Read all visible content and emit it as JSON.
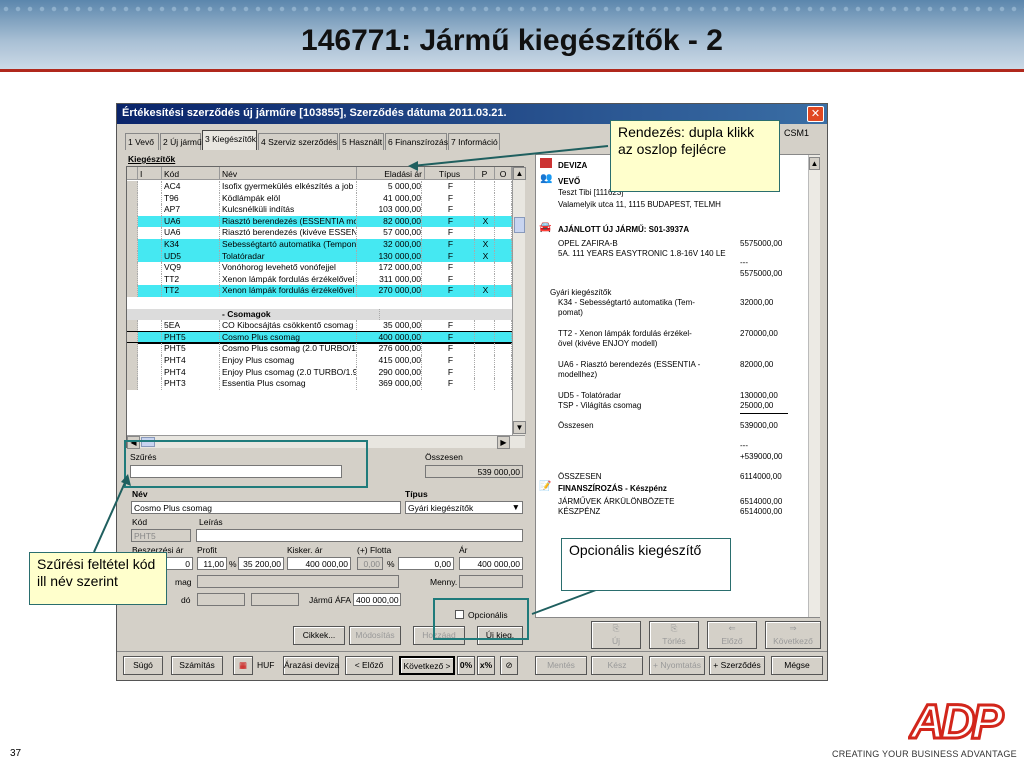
{
  "slide": {
    "title": "146771: Jármű kiegészítők - 2",
    "page": "37",
    "tagline": "CREATING YOUR BUSINESS ADVANTAGE",
    "logo": "ADP"
  },
  "window": {
    "title": "Értékesítési szerződés új járműre [103855], Szerződés dátuma 2011.03.21.",
    "csm": "CSM1"
  },
  "tabs": [
    "1 Vevő",
    "2 Új jármű",
    "3 Kiegészítők",
    "4 Szerviz szerződés",
    "5 Használt",
    "6 Finanszírozás",
    "7 Információ"
  ],
  "grid": {
    "section_label": "Kiegészítők",
    "headers": [
      "I",
      "Kód",
      "Név",
      "Eladási ár",
      "Típus",
      "P",
      "O"
    ],
    "group_label": "- Csomagok",
    "rows": [
      {
        "kod": "AC4",
        "nev": "Isofix gyermekülés elkészítés a job",
        "ar": "5 000,00",
        "tipus": "F",
        "p": ""
      },
      {
        "kod": "T96",
        "nev": "Ködlámpák elöl",
        "ar": "41 000,00",
        "tipus": "F",
        "p": ""
      },
      {
        "kod": "AP7",
        "nev": "Kulcsnélküli indítás",
        "ar": "103 000,00",
        "tipus": "F",
        "p": ""
      },
      {
        "kod": "UA6",
        "nev": "Riasztó berendezés (ESSENTIA mc",
        "ar": "82 000,00",
        "tipus": "F",
        "p": "X",
        "hl": true
      },
      {
        "kod": "UA6",
        "nev": "Riasztó berendezés (kivéve ESSEN",
        "ar": "57 000,00",
        "tipus": "F",
        "p": ""
      },
      {
        "kod": "K34",
        "nev": "Sebességtartó automatika (Tempon",
        "ar": "32 000,00",
        "tipus": "F",
        "p": "X",
        "hl": true
      },
      {
        "kod": "UD5",
        "nev": "Tolatóradar",
        "ar": "130 000,00",
        "tipus": "F",
        "p": "X",
        "hl": true
      },
      {
        "kod": "VQ9",
        "nev": "Vonóhorog levehető vonófejjel",
        "ar": "172 000,00",
        "tipus": "F",
        "p": ""
      },
      {
        "kod": "TT2",
        "nev": "Xenon lámpák fordulás érzékelővel",
        "ar": "311 000,00",
        "tipus": "F",
        "p": ""
      },
      {
        "kod": "TT2",
        "nev": "Xenon lámpák fordulás érzékelővel",
        "ar": "270 000,00",
        "tipus": "F",
        "p": "X",
        "hl": true
      },
      {
        "kod": "5EA",
        "nev": "CO Kibocsájtás csökkentő csomag",
        "ar": "35 000,00",
        "tipus": "F",
        "p": ""
      },
      {
        "kod": "PHT5",
        "nev": "Cosmo Plus csomag",
        "ar": "400 000,00",
        "tipus": "F",
        "p": "",
        "hl": true
      },
      {
        "kod": "PHT5",
        "nev": "Cosmo Plus csomag (2.0 TURBO/1",
        "ar": "276 000,00",
        "tipus": "F",
        "p": ""
      },
      {
        "kod": "PHT4",
        "nev": "Enjoy Plus csomag",
        "ar": "415 000,00",
        "tipus": "F",
        "p": ""
      },
      {
        "kod": "PHT4",
        "nev": "Enjoy Plus csomag (2.0 TURBO/1.9",
        "ar": "290 000,00",
        "tipus": "F",
        "p": ""
      },
      {
        "kod": "PHT3",
        "nev": "Essentia Plus csomag",
        "ar": "369 000,00",
        "tipus": "F",
        "p": ""
      }
    ]
  },
  "filter": {
    "szures_label": "Szűrés",
    "szures_value": "",
    "osszesen_label": "Összesen",
    "osszesen_value": "539 000,00"
  },
  "detail": {
    "nev_label": "Név",
    "nev_value": "Cosmo Plus csomag",
    "tipus_label": "Típus",
    "tipus_value": "Gyári kiegészítők",
    "kod_label": "Kód",
    "kod_value": "PHT5",
    "leiras_label": "Leírás",
    "beszerzesi_label": "Beszerzési ár",
    "profit_label": "Profit",
    "kisker_label": "Kisker. ár",
    "flotta_label": "(+) Flotta",
    "ar_label": "Ár",
    "beszerzesi_value": "0",
    "profit_pct": "11,00",
    "profit_value": "35 200,00",
    "kisker_value": "400 000,00",
    "flotta_value": "0,00",
    "flotta_pct": "0,00",
    "ar_value": "400 000,00",
    "mag_label": "mag",
    "menny_label": "Menny.",
    "ado_label": "dó",
    "jarmu_afa_label": "Jármű ÁFA",
    "jarmu_afa_value": "400 000,00",
    "opcionalis_label": "Opcionális",
    "cikkek_btn": "Cikkek...",
    "modositas_btn": "Módosítás",
    "hozzaad_btn": "Hozzáad",
    "ujkieg_btn": "Új kieg."
  },
  "right": {
    "deviza": "DEVIZA",
    "vevo": "VEVŐ",
    "vevo_name": "Teszt Tibi [111623]",
    "vevo_addr": "Valamelyik utca 11, 1115 BUDAPEST, TELMH",
    "ajanlott": "AJÁNLOTT ÚJ JÁRMŰ: S01-3937A",
    "car1": "OPEL ZAFIRA-B",
    "car1_val": "5575000,00",
    "car2": "5A. 111 YEARS EASYTRONIC 1.8-16V 140 LE",
    "dash1": "---",
    "car_total": "5575000,00",
    "gyari": "Gyári kiegészítők",
    "k34a": "K34 - Sebességtartó automatika (Tem-",
    "k34b": "pomat)",
    "k34_val": "32000,00",
    "tt2a": "TT2 - Xenon lámpák fordulás érzékel-",
    "tt2b": "övel (kivéve ENJOY modell)",
    "tt2_val": "270000,00",
    "ua6a": "UA6 - Riasztó berendezés (ESSENTIA -",
    "ua6b": "modellhez)",
    "ua6_val": "82000,00",
    "ud5": "UD5 - Tolatóradar",
    "ud5_val": "130000,00",
    "tsp": "TSP - Világítás csomag",
    "tsp_val": "25000,00",
    "osszesen": "Összesen",
    "osszesen_val": "539000,00",
    "dash2": "---",
    "plus_val": "+539000,00",
    "osszesen2": "ÖSSZESEN",
    "osszesen2_val": "6114000,00",
    "finansz": "FINANSZÍROZÁS - Készpénz",
    "kulonbozet": "JÁRMŰVEK ÁRKÜLÖNBÖZETE",
    "kulonbozet_val": "6514000,00",
    "keszpenz": "KÉSZPÉNZ",
    "keszpenz_val": "6514000,00",
    "nav": [
      "Új",
      "Törlés",
      "Előző",
      "Következő"
    ]
  },
  "bottom": {
    "sugo": "Súgó",
    "szamitas": "Számítás",
    "huf": "HUF",
    "arazasi": "Árazási deviza",
    "elozo": "< Előző",
    "kovetkezo": "Következő >",
    "pct0": "0%",
    "xpct": "x%",
    "mentes": "Mentés",
    "kesz": "Kész",
    "nyomtatas": "+ Nyomtatás",
    "szerzodes": "+ Szerződés",
    "megse": "Mégse"
  },
  "callouts": {
    "sort": "Rendezés: dupla klikk az oszlop fejlécre",
    "filter": "Szűrési feltétel kód ill név szerint",
    "optional": "Opcionális kiegészítő"
  }
}
